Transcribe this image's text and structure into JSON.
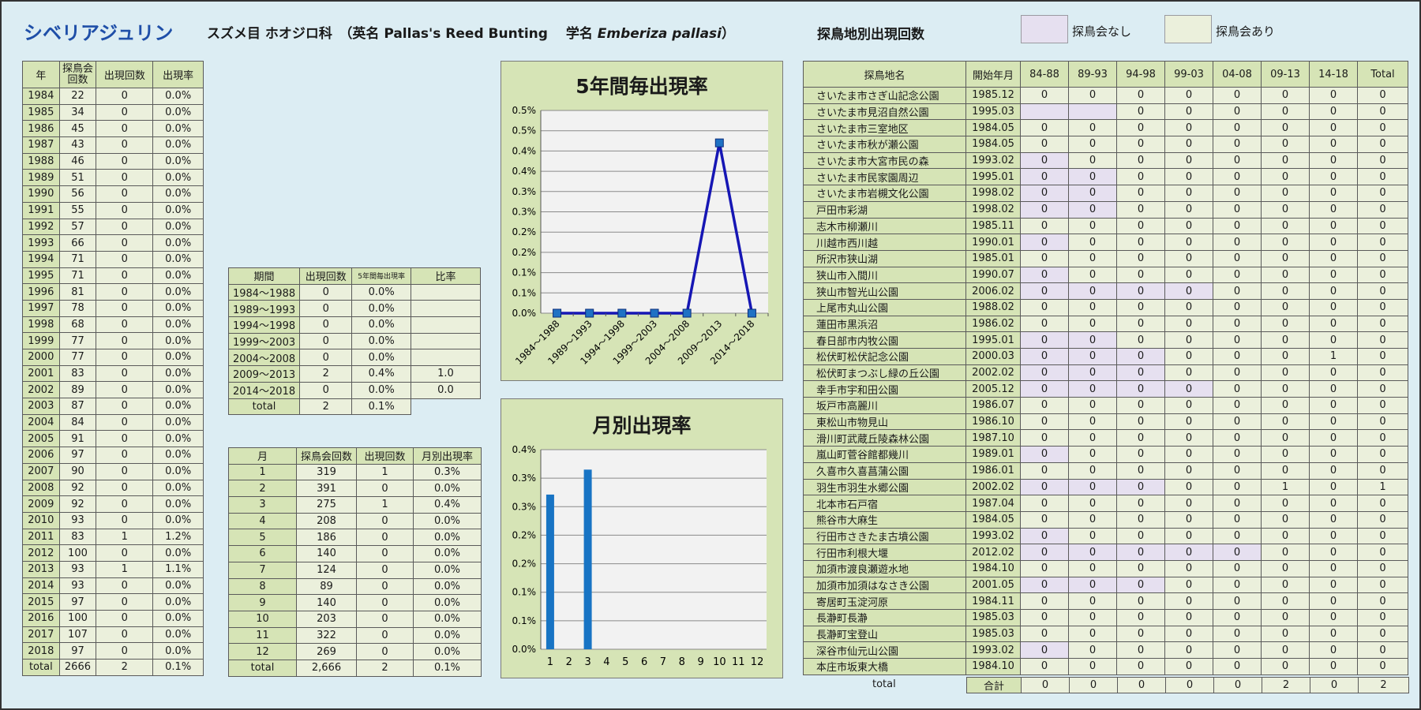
{
  "header": {
    "title": "シベリアジュリン",
    "classification": "スズメ目 ホオジロ科　（英名 Pallas's Reed Bunting　 学名",
    "scientific_name": "Emberiza pallasi",
    "closing_paren": "）",
    "site_heading": "探鳥地別出現回数",
    "legend_none": "探鳥会なし",
    "legend_some": "探鳥会あり"
  },
  "colors": {
    "header_green": "#d6e4b6",
    "cell_green": "#ebf0dc",
    "no_survey_purple": "#e6e0f0",
    "line": "#1616b4",
    "bar": "#1874c4",
    "title_blue": "#1f4fa8"
  },
  "year_table": {
    "headers": [
      "年",
      "探鳥会回数",
      "出現回数",
      "出現率"
    ],
    "rows": [
      [
        "1984",
        "22",
        "0",
        "0.0%"
      ],
      [
        "1985",
        "34",
        "0",
        "0.0%"
      ],
      [
        "1986",
        "45",
        "0",
        "0.0%"
      ],
      [
        "1987",
        "43",
        "0",
        "0.0%"
      ],
      [
        "1988",
        "46",
        "0",
        "0.0%"
      ],
      [
        "1989",
        "51",
        "0",
        "0.0%"
      ],
      [
        "1990",
        "56",
        "0",
        "0.0%"
      ],
      [
        "1991",
        "55",
        "0",
        "0.0%"
      ],
      [
        "1992",
        "57",
        "0",
        "0.0%"
      ],
      [
        "1993",
        "66",
        "0",
        "0.0%"
      ],
      [
        "1994",
        "71",
        "0",
        "0.0%"
      ],
      [
        "1995",
        "71",
        "0",
        "0.0%"
      ],
      [
        "1996",
        "81",
        "0",
        "0.0%"
      ],
      [
        "1997",
        "78",
        "0",
        "0.0%"
      ],
      [
        "1998",
        "68",
        "0",
        "0.0%"
      ],
      [
        "1999",
        "77",
        "0",
        "0.0%"
      ],
      [
        "2000",
        "77",
        "0",
        "0.0%"
      ],
      [
        "2001",
        "83",
        "0",
        "0.0%"
      ],
      [
        "2002",
        "89",
        "0",
        "0.0%"
      ],
      [
        "2003",
        "87",
        "0",
        "0.0%"
      ],
      [
        "2004",
        "84",
        "0",
        "0.0%"
      ],
      [
        "2005",
        "91",
        "0",
        "0.0%"
      ],
      [
        "2006",
        "97",
        "0",
        "0.0%"
      ],
      [
        "2007",
        "90",
        "0",
        "0.0%"
      ],
      [
        "2008",
        "92",
        "0",
        "0.0%"
      ],
      [
        "2009",
        "92",
        "0",
        "0.0%"
      ],
      [
        "2010",
        "93",
        "0",
        "0.0%"
      ],
      [
        "2011",
        "83",
        "1",
        "1.2%"
      ],
      [
        "2012",
        "100",
        "0",
        "0.0%"
      ],
      [
        "2013",
        "93",
        "1",
        "1.1%"
      ],
      [
        "2014",
        "93",
        "0",
        "0.0%"
      ],
      [
        "2015",
        "97",
        "0",
        "0.0%"
      ],
      [
        "2016",
        "100",
        "0",
        "0.0%"
      ],
      [
        "2017",
        "107",
        "0",
        "0.0%"
      ],
      [
        "2018",
        "97",
        "0",
        "0.0%"
      ]
    ],
    "total": [
      "total",
      "2666",
      "2",
      "0.1%"
    ]
  },
  "period_table": {
    "headers": [
      "期間",
      "出現回数",
      "5年間毎出現率",
      "比率"
    ],
    "rows": [
      [
        "1984～1988",
        "0",
        "0.0%",
        ""
      ],
      [
        "1989～1993",
        "0",
        "0.0%",
        ""
      ],
      [
        "1994～1998",
        "0",
        "0.0%",
        ""
      ],
      [
        "1999～2003",
        "0",
        "0.0%",
        ""
      ],
      [
        "2004～2008",
        "0",
        "0.0%",
        ""
      ],
      [
        "2009～2013",
        "2",
        "0.4%",
        "1.0"
      ],
      [
        "2014～2018",
        "0",
        "0.0%",
        "0.0"
      ]
    ],
    "total": [
      "total",
      "2",
      "0.1%"
    ]
  },
  "month_table": {
    "headers": [
      "月",
      "探鳥会回数",
      "出現回数",
      "月別出現率"
    ],
    "rows": [
      [
        "1",
        "319",
        "1",
        "0.3%"
      ],
      [
        "2",
        "391",
        "0",
        "0.0%"
      ],
      [
        "3",
        "275",
        "1",
        "0.4%"
      ],
      [
        "4",
        "208",
        "0",
        "0.0%"
      ],
      [
        "5",
        "186",
        "0",
        "0.0%"
      ],
      [
        "6",
        "140",
        "0",
        "0.0%"
      ],
      [
        "7",
        "124",
        "0",
        "0.0%"
      ],
      [
        "8",
        "89",
        "0",
        "0.0%"
      ],
      [
        "9",
        "140",
        "0",
        "0.0%"
      ],
      [
        "10",
        "203",
        "0",
        "0.0%"
      ],
      [
        "11",
        "322",
        "0",
        "0.0%"
      ],
      [
        "12",
        "269",
        "0",
        "0.0%"
      ]
    ],
    "total": [
      "total",
      "2,666",
      "2",
      "0.1%"
    ]
  },
  "site_table": {
    "headers": [
      "探鳥地名",
      "開始年月",
      "84-88",
      "89-93",
      "94-98",
      "99-03",
      "04-08",
      "09-13",
      "14-18",
      "Total"
    ],
    "rows": [
      {
        "cells": [
          "さいたま市さぎ山記念公園",
          "1985.12",
          "0",
          "0",
          "0",
          "0",
          "0",
          "0",
          "0",
          "0"
        ],
        "none": []
      },
      {
        "cells": [
          "さいたま市見沼自然公園",
          "1995.03",
          "",
          "",
          "0",
          "0",
          "0",
          "0",
          "0",
          "0"
        ],
        "none": [
          0,
          1
        ]
      },
      {
        "cells": [
          "さいたま市三室地区",
          "1984.05",
          "0",
          "0",
          "0",
          "0",
          "0",
          "0",
          "0",
          "0"
        ],
        "none": []
      },
      {
        "cells": [
          "さいたま市秋が瀬公園",
          "1984.05",
          "0",
          "0",
          "0",
          "0",
          "0",
          "0",
          "0",
          "0"
        ],
        "none": []
      },
      {
        "cells": [
          "さいたま市大宮市民の森",
          "1993.02",
          "0",
          "0",
          "0",
          "0",
          "0",
          "0",
          "0",
          "0"
        ],
        "none": [
          0
        ]
      },
      {
        "cells": [
          "さいたま市民家園周辺",
          "1995.01",
          "0",
          "0",
          "0",
          "0",
          "0",
          "0",
          "0",
          "0"
        ],
        "none": [
          0,
          1
        ]
      },
      {
        "cells": [
          "さいたま市岩槻文化公園",
          "1998.02",
          "0",
          "0",
          "0",
          "0",
          "0",
          "0",
          "0",
          "0"
        ],
        "none": [
          0,
          1
        ]
      },
      {
        "cells": [
          "戸田市彩湖",
          "1998.02",
          "0",
          "0",
          "0",
          "0",
          "0",
          "0",
          "0",
          "0"
        ],
        "none": [
          0,
          1
        ]
      },
      {
        "cells": [
          "志木市柳瀬川",
          "1985.11",
          "0",
          "0",
          "0",
          "0",
          "0",
          "0",
          "0",
          "0"
        ],
        "none": []
      },
      {
        "cells": [
          "川越市西川越",
          "1990.01",
          "0",
          "0",
          "0",
          "0",
          "0",
          "0",
          "0",
          "0"
        ],
        "none": [
          0
        ]
      },
      {
        "cells": [
          "所沢市狭山湖",
          "1985.01",
          "0",
          "0",
          "0",
          "0",
          "0",
          "0",
          "0",
          "0"
        ],
        "none": []
      },
      {
        "cells": [
          "狭山市入間川",
          "1990.07",
          "0",
          "0",
          "0",
          "0",
          "0",
          "0",
          "0",
          "0"
        ],
        "none": [
          0
        ]
      },
      {
        "cells": [
          "狭山市智光山公園",
          "2006.02",
          "0",
          "0",
          "0",
          "0",
          "0",
          "0",
          "0",
          "0"
        ],
        "none": [
          0,
          1,
          2,
          3
        ]
      },
      {
        "cells": [
          "上尾市丸山公園",
          "1988.02",
          "0",
          "0",
          "0",
          "0",
          "0",
          "0",
          "0",
          "0"
        ],
        "none": []
      },
      {
        "cells": [
          "蓮田市黒浜沼",
          "1986.02",
          "0",
          "0",
          "0",
          "0",
          "0",
          "0",
          "0",
          "0"
        ],
        "none": []
      },
      {
        "cells": [
          "春日部市内牧公園",
          "1995.01",
          "0",
          "0",
          "0",
          "0",
          "0",
          "0",
          "0",
          "0"
        ],
        "none": [
          0,
          1
        ]
      },
      {
        "cells": [
          "松伏町松伏記念公園",
          "2000.03",
          "0",
          "0",
          "0",
          "0",
          "0",
          "0",
          "1",
          "0",
          "1"
        ],
        "none": [
          0,
          1,
          2
        ]
      },
      {
        "cells": [
          "松伏町まつぶし緑の丘公園",
          "2002.02",
          "0",
          "0",
          "0",
          "0",
          "0",
          "0",
          "0",
          "0"
        ],
        "none": [
          0,
          1,
          2
        ]
      },
      {
        "cells": [
          "幸手市宇和田公園",
          "2005.12",
          "0",
          "0",
          "0",
          "0",
          "0",
          "0",
          "0",
          "0"
        ],
        "none": [
          0,
          1,
          2,
          3
        ]
      },
      {
        "cells": [
          "坂戸市高麗川",
          "1986.07",
          "0",
          "0",
          "0",
          "0",
          "0",
          "0",
          "0",
          "0"
        ],
        "none": []
      },
      {
        "cells": [
          "東松山市物見山",
          "1986.10",
          "0",
          "0",
          "0",
          "0",
          "0",
          "0",
          "0",
          "0"
        ],
        "none": []
      },
      {
        "cells": [
          "滑川町武蔵丘陵森林公園",
          "1987.10",
          "0",
          "0",
          "0",
          "0",
          "0",
          "0",
          "0",
          "0"
        ],
        "none": []
      },
      {
        "cells": [
          "嵐山町菅谷館都幾川",
          "1989.01",
          "0",
          "0",
          "0",
          "0",
          "0",
          "0",
          "0",
          "0"
        ],
        "none": [
          0
        ]
      },
      {
        "cells": [
          "久喜市久喜菖蒲公園",
          "1986.01",
          "0",
          "0",
          "0",
          "0",
          "0",
          "0",
          "0",
          "0"
        ],
        "none": []
      },
      {
        "cells": [
          "羽生市羽生水郷公園",
          "2002.02",
          "0",
          "0",
          "0",
          "0",
          "0",
          "1",
          "0",
          "1"
        ],
        "none": [
          0,
          1,
          2
        ]
      },
      {
        "cells": [
          "北本市石戸宿",
          "1987.04",
          "0",
          "0",
          "0",
          "0",
          "0",
          "0",
          "0",
          "0"
        ],
        "none": []
      },
      {
        "cells": [
          "熊谷市大麻生",
          "1984.05",
          "0",
          "0",
          "0",
          "0",
          "0",
          "0",
          "0",
          "0"
        ],
        "none": []
      },
      {
        "cells": [
          "行田市さきたま古墳公園",
          "1993.02",
          "0",
          "0",
          "0",
          "0",
          "0",
          "0",
          "0",
          "0"
        ],
        "none": [
          0
        ]
      },
      {
        "cells": [
          "行田市利根大堰",
          "2012.02",
          "0",
          "0",
          "0",
          "0",
          "0",
          "0",
          "0",
          "0"
        ],
        "none": [
          0,
          1,
          2,
          3,
          4
        ]
      },
      {
        "cells": [
          "加須市渡良瀬遊水地",
          "1984.10",
          "0",
          "0",
          "0",
          "0",
          "0",
          "0",
          "0",
          "0"
        ],
        "none": []
      },
      {
        "cells": [
          "加須市加須はなさき公園",
          "2001.05",
          "0",
          "0",
          "0",
          "0",
          "0",
          "0",
          "0",
          "0"
        ],
        "none": [
          0,
          1,
          2
        ]
      },
      {
        "cells": [
          "寄居町玉淀河原",
          "1984.11",
          "0",
          "0",
          "0",
          "0",
          "0",
          "0",
          "0",
          "0"
        ],
        "none": []
      },
      {
        "cells": [
          "長瀞町長瀞",
          "1985.03",
          "0",
          "0",
          "0",
          "0",
          "0",
          "0",
          "0",
          "0"
        ],
        "none": []
      },
      {
        "cells": [
          "長瀞町宝登山",
          "1985.03",
          "0",
          "0",
          "0",
          "0",
          "0",
          "0",
          "0",
          "0"
        ],
        "none": []
      },
      {
        "cells": [
          "深谷市仙元山公園",
          "1993.02",
          "0",
          "0",
          "0",
          "0",
          "0",
          "0",
          "0",
          "0"
        ],
        "none": [
          0
        ]
      },
      {
        "cells": [
          "本庄市坂東大橋",
          "1984.10",
          "0",
          "0",
          "0",
          "0",
          "0",
          "0",
          "0",
          "0"
        ],
        "none": []
      }
    ],
    "total_label": "total",
    "sum_label": "合計",
    "sum_values": [
      "0",
      "0",
      "0",
      "0",
      "0",
      "2",
      "0",
      "2"
    ]
  },
  "chart_data": [
    {
      "type": "line",
      "title": "5年間毎出現率",
      "categories": [
        "1984～1988",
        "1989～1993",
        "1994～1998",
        "1999～2003",
        "2004～2008",
        "2009～2013",
        "2014～2018"
      ],
      "values": [
        0.0,
        0.0,
        0.0,
        0.0,
        0.0,
        0.42,
        0.0
      ],
      "ylim": [
        0,
        0.5
      ],
      "yticks": [
        "0.0%",
        "0.1%",
        "0.1%",
        "0.2%",
        "0.2%",
        "0.3%",
        "0.3%",
        "0.4%",
        "0.4%",
        "0.5%",
        "0.5%"
      ],
      "grid": true
    },
    {
      "type": "bar",
      "title": "月別出現率",
      "categories": [
        "1",
        "2",
        "3",
        "4",
        "5",
        "6",
        "7",
        "8",
        "9",
        "10",
        "11",
        "12"
      ],
      "values": [
        0.31,
        0,
        0.36,
        0,
        0,
        0,
        0,
        0,
        0,
        0,
        0,
        0
      ],
      "ylim": [
        0,
        0.4
      ],
      "yticks": [
        "0.0%",
        "0.1%",
        "0.1%",
        "0.2%",
        "0.2%",
        "0.3%",
        "0.3%",
        "0.4%"
      ],
      "grid": true
    }
  ]
}
